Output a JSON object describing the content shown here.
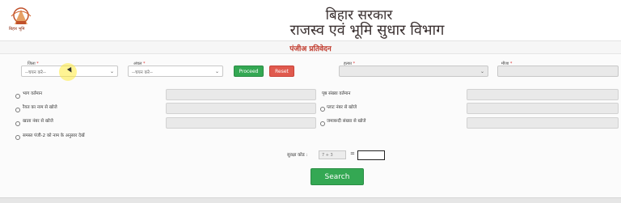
{
  "header": {
    "logo_caption": "बिहार भूमि",
    "title_line1": "बिहार सरकार",
    "title_line2": "राजस्व एवं भूमि सुधार विभाग"
  },
  "band": {
    "title": "पंजीअ प्रतिवेदन"
  },
  "filters": {
    "district_label": "जिला",
    "district_value": "--चयन करे--",
    "circle_label": "अंचल",
    "circle_value": "--चयन करे--",
    "proceed_label": "Proceed",
    "reset_label": "Reset",
    "halka_label": "हल्का",
    "mauja_label": "मौजा"
  },
  "options": [
    {
      "label": "भाग वर्तमान"
    },
    {
      "label": "रैयत का नाम से खोजे"
    },
    {
      "label": "खाता नंबर से खोजे"
    },
    {
      "label": "समस्त पंजी-2 को नाम के अनुसार देखें"
    }
  ],
  "options_right": [
    {
      "label": "पृष्ठ संख्या वर्तमान"
    },
    {
      "label": "प्लाट नंबर से खोजे"
    },
    {
      "label": "जमाबन्दी संख्या से खोजे"
    }
  ],
  "captcha": {
    "label": "सुरक्षा कोड :",
    "expression": "7 + 3",
    "equals": "=",
    "answer": ""
  },
  "search_label": "Search"
}
